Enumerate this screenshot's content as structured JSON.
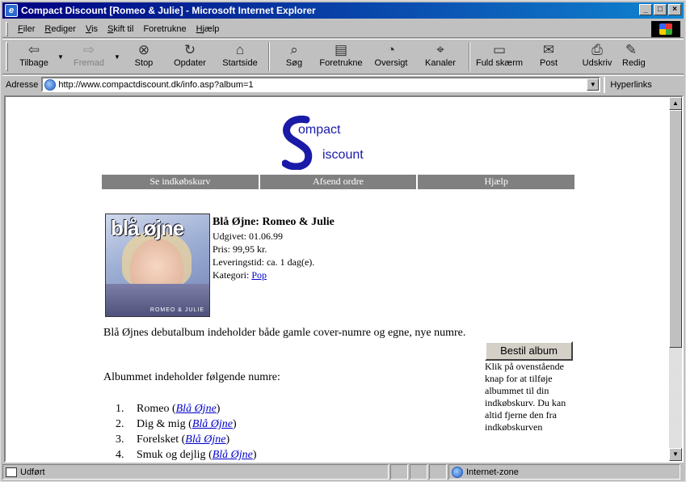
{
  "window": {
    "title": "Compact Discount [Romeo & Julie] - Microsoft Internet Explorer"
  },
  "menu": [
    {
      "label": "Filer",
      "accel": "F",
      "rest": "iler"
    },
    {
      "label": "Rediger",
      "accel": "R",
      "rest": "ediger"
    },
    {
      "label": "Vis",
      "accel": "V",
      "rest": "is"
    },
    {
      "label": "Skift til",
      "accel": "S",
      "rest": "kift til"
    },
    {
      "label": "Foretrukne",
      "accel": "",
      "rest": "Foretrukne"
    },
    {
      "label": "Hjælp",
      "accel": "H",
      "rest": "jælp"
    }
  ],
  "toolbar": {
    "back": "Tilbage",
    "forward": "Fremad",
    "stop": "Stop",
    "refresh": "Opdater",
    "home": "Startside",
    "search": "Søg",
    "favorites": "Foretrukne",
    "history": "Oversigt",
    "channels": "Kanaler",
    "fullscreen": "Fuld skærm",
    "mail": "Post",
    "print": "Udskriv",
    "edit": "Redig"
  },
  "address": {
    "label": "Adresse",
    "url": "http://www.compactdiscount.dk/info.asp?album=1",
    "links": "Hyperlinks"
  },
  "site": {
    "logo_c": "ompact",
    "logo_d": "iscount",
    "nav": [
      "Se indkøbskurv",
      "Afsend ordre",
      "Hjælp"
    ]
  },
  "album": {
    "cover_title": "blå øjne",
    "cover_sub": "ROMEO & JULIE",
    "title": "Blå Øjne: Romeo & Julie",
    "released": "Udgivet: 01.06.99",
    "price": "Pris: 99,95 kr.",
    "delivery": "Leveringstid: ca. 1 dag(e).",
    "category_label": "Kategori: ",
    "category": "Pop",
    "description": "Blå Øjnes debutalbum indeholder både gamle cover-numre og egne, nye numre.",
    "tracks_intro": "Albummet indeholder følgende numre:",
    "tracks": [
      {
        "num": "1.",
        "name": "Romeo",
        "artist": "Blå Øjne"
      },
      {
        "num": "2.",
        "name": "Dig & mig",
        "artist": "Blå Øjne"
      },
      {
        "num": "3.",
        "name": "Forelsket",
        "artist": "Blå Øjne"
      },
      {
        "num": "4.",
        "name": "Smuk og dejlig",
        "artist": "Blå Øjne"
      }
    ],
    "order_button": "Bestil album",
    "order_help": "Klik på ovenstående knap for at tilføje albummet til din indkøbskurv. Du kan altid fjerne den fra indkøbskurven"
  },
  "status": {
    "text": "Udført",
    "zone": "Internet-zone"
  }
}
